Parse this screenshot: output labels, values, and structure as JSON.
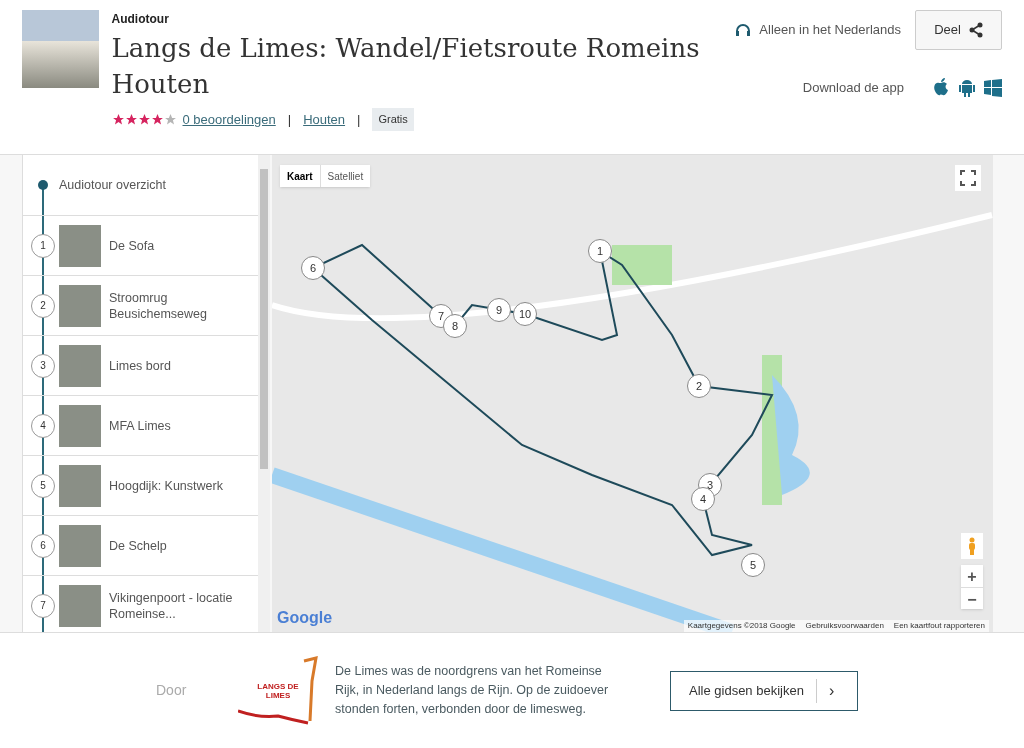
{
  "header": {
    "kind_label": "Audiotour",
    "title": "Langs de Limes: Wandel/Fietsroute Romeins Houten",
    "stars": 4,
    "reviews": "0 beoordelingen",
    "separator": "|",
    "city": "Houten",
    "price": "Gratis",
    "language": "Alleen in het Nederlands",
    "share": "Deel",
    "download": "Download de app"
  },
  "sidebar": {
    "overview": "Audiotour overzicht",
    "stops": [
      {
        "number": "1",
        "name": "De Sofa"
      },
      {
        "number": "2",
        "name": "Stroomrug Beusichemseweg"
      },
      {
        "number": "3",
        "name": "Limes bord"
      },
      {
        "number": "4",
        "name": "MFA Limes"
      },
      {
        "number": "5",
        "name": "Hoogdijk: Kunstwerk"
      },
      {
        "number": "6",
        "name": "De Schelp"
      },
      {
        "number": "7",
        "name": "Vikingenpoort - locatie Romeinse..."
      }
    ]
  },
  "map": {
    "map_type_tabs": [
      {
        "label": "Kaart",
        "selected": true
      },
      {
        "label": "Satelliet",
        "selected": false
      }
    ],
    "markers": [
      "1",
      "2",
      "3",
      "4",
      "5",
      "6",
      "7",
      "8",
      "9",
      "10"
    ],
    "zoom_in": "+",
    "zoom_out": "−",
    "brand": "Google",
    "attribution": [
      "Kaartgegevens ©2018 Google",
      "Gebruiksvoorwaarden",
      "Een kaartfout rapporteren"
    ]
  },
  "footer": {
    "by": "Door",
    "logo_text": [
      "LANGS DE",
      "LIMES"
    ],
    "description": "De Limes was de noordgrens van het Romeinse Rijk, in Nederland langs de Rijn. Op de zuidoever stonden forten, verbonden door de limesweg.",
    "button": "Alle gidsen bekijken",
    "button_arrow": "›"
  }
}
